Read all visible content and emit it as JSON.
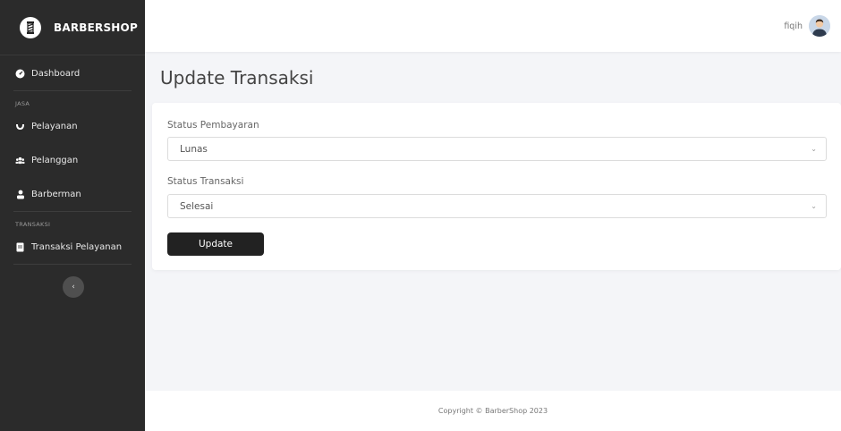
{
  "brand": {
    "name": "BARBERSHOP"
  },
  "sidebar": {
    "items": [
      {
        "label": "Dashboard"
      },
      {
        "label": "Pelayanan"
      },
      {
        "label": "Pelanggan"
      },
      {
        "label": "Barberman"
      },
      {
        "label": "Transaksi Pelayanan"
      }
    ],
    "headings": [
      "JASA",
      "TRANSAKSI"
    ],
    "toggle_icon": "‹"
  },
  "topbar": {
    "user_name": "fiqih"
  },
  "page": {
    "title": "Update Transaksi"
  },
  "form": {
    "payment_status_label": "Status Pembayaran",
    "payment_status_value": "Lunas",
    "transaction_status_label": "Status Transaksi",
    "transaction_status_value": "Selesai",
    "chevron": "⌄",
    "submit_label": "Update"
  },
  "footer": {
    "text": "Copyright © BarberShop 2023"
  },
  "colors": {
    "sidebar_bg": "#2b2b2b",
    "button_bg": "#222222",
    "page_bg": "#f4f5f8"
  }
}
